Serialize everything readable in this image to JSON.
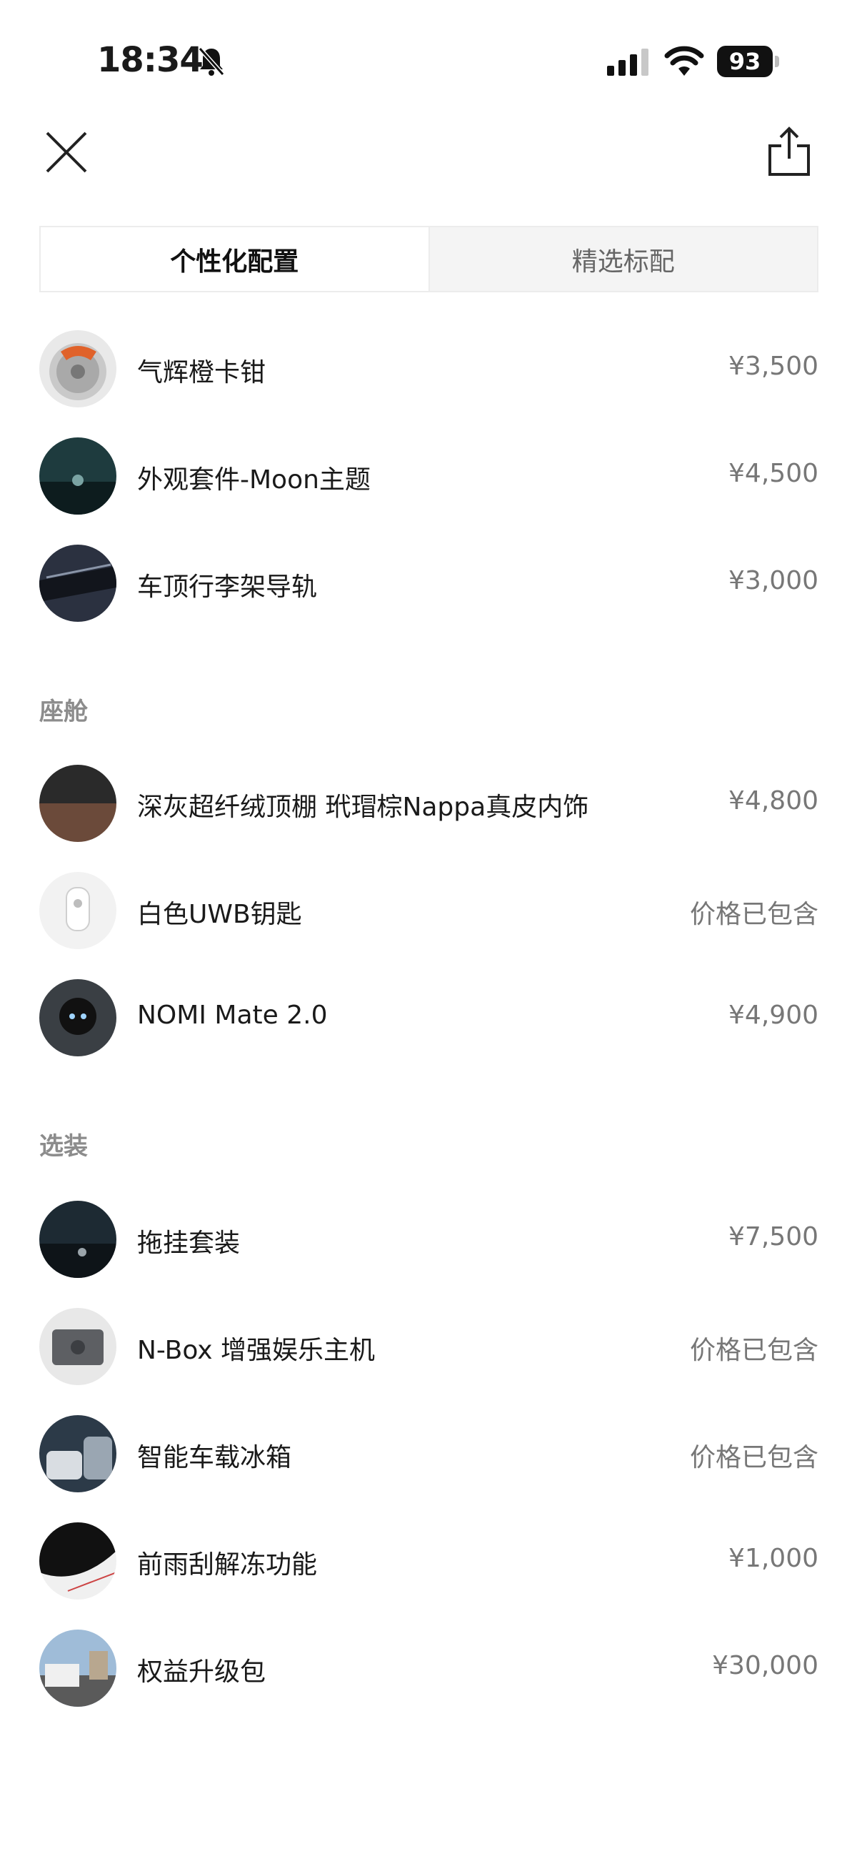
{
  "status": {
    "time": "18:34",
    "battery": "93"
  },
  "tabs": [
    {
      "label": "个性化配置"
    },
    {
      "label": "精选标配"
    }
  ],
  "sections": {
    "cabin": "座舱",
    "options": "选装"
  },
  "items": [
    {
      "name": "气辉橙卡钳",
      "price": "¥3,500"
    },
    {
      "name": "外观套件-Moon主题",
      "price": "¥4,500"
    },
    {
      "name": "车顶行李架导轨",
      "price": "¥3,000"
    },
    {
      "name": "深灰超纤绒顶棚 玳瑁棕Nappa真皮内饰",
      "price": "¥4,800"
    },
    {
      "name": "白色UWB钥匙",
      "price": "价格已包含"
    },
    {
      "name": "NOMI Mate 2.0",
      "price": "¥4,900"
    },
    {
      "name": "拖挂套装",
      "price": "¥7,500"
    },
    {
      "name": "N-Box 增强娱乐主机",
      "price": "价格已包含"
    },
    {
      "name": "智能车载冰箱",
      "price": "价格已包含"
    },
    {
      "name": "前雨刮解冻功能",
      "price": "¥1,000"
    },
    {
      "name": "权益升级包",
      "price": "¥30,000"
    }
  ]
}
